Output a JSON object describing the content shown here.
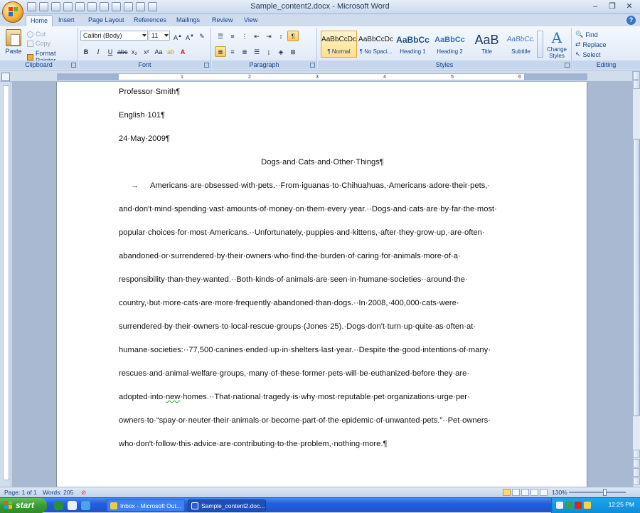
{
  "window": {
    "title": "Sample_content2.docx - Microsoft Word"
  },
  "ribbon": {
    "tabs": [
      {
        "label": "Home"
      },
      {
        "label": "Insert"
      },
      {
        "label": "Page Layout"
      },
      {
        "label": "References"
      },
      {
        "label": "Mailings"
      },
      {
        "label": "Review"
      },
      {
        "label": "View"
      }
    ],
    "clipboard": {
      "label": "Clipboard",
      "paste": "Paste",
      "cut": "Cut",
      "copy": "Copy",
      "format_painter": "Format Painter"
    },
    "font": {
      "label": "Font",
      "family": "Calibri (Body)",
      "size": "11"
    },
    "paragraph": {
      "label": "Paragraph"
    },
    "styles": {
      "label": "Styles",
      "items": [
        {
          "sample": "AaBbCcDc",
          "name": "¶ Normal"
        },
        {
          "sample": "AaBbCcDc",
          "name": "¶ No Spaci..."
        },
        {
          "sample": "AaBbCc",
          "name": "Heading 1"
        },
        {
          "sample": "AaBbCc",
          "name": "Heading 2"
        },
        {
          "sample": "AaB",
          "name": "Title"
        },
        {
          "sample": "AaBbCc.",
          "name": "Subtitle"
        }
      ],
      "change_styles": "Change Styles"
    },
    "editing": {
      "label": "Editing",
      "find": "Find",
      "replace": "Replace",
      "select": "Select"
    }
  },
  "ruler": {
    "numbers": [
      "1",
      "2",
      "3",
      "4",
      "5",
      "6"
    ]
  },
  "document": {
    "lines": [
      "Professor·Smith¶",
      "English·101¶",
      "24·May·2009¶"
    ],
    "title": "Dogs·and·Cats·and·Other·Things¶",
    "tab_mark": "→",
    "body": [
      "Americans·are·obsessed·with·pets.··From·iguanas·to·Chihuahuas,·Americans·adore·their·pets,·",
      "and·don't·mind·spending·vast·amounts·of·money·on·them·every·year.··Dogs·and·cats·are·by·far·the·most·",
      "popular·choices·for·most·Americans.··Unfortunately,·puppies·and·kittens,·after·they·grow·up,·are·often·",
      "abandoned·or·surrendered·by·their·owners·who·find·the·burden·of·caring·for·animals·more·of·a·",
      "responsibility·than·they·wanted.··Both·kinds·of·animals·are·seen·in·humane·societies··around·the·",
      "country,·but·more·cats·are·more·frequently·abandoned·than·dogs.··In·2008,·400,000·cats·were·",
      "surrendered·by·their·owners·to·local·rescue·groups·(Jones·25).·Dogs·don't·turn·up·quite·as·often·at·",
      "humane·societies:··77,500·canines·ended·up·in·shelters·last·year.··Despite·the·good·intentions·of·many·",
      "rescues·and·animal·welfare·groups,·many·of·these·former·pets·will·be·euthanized·before·they·are·",
      "owners·to·“spay·or·neuter·their·animals·or·become·part·of·the·epidemic·of·unwanted·pets.”··Pet·owners·",
      "who·don't·follow·this·advice·are·contributing·to·the·problem,·nothing·more.¶"
    ],
    "adopted_prefix": "adopted·into·",
    "adopted_word": "new",
    "adopted_suffix": "·homes.··That·national·tragedy·is·why·most·reputable·pet·organizations·urge·per·"
  },
  "status": {
    "page": "Page: 1 of 1",
    "words": "Words: 205",
    "zoom": "130%"
  },
  "taskbar": {
    "start": "start",
    "tasks": [
      {
        "label": "Inbox - Microsoft Out..."
      },
      {
        "label": "Sample_content2.doc..."
      }
    ],
    "clock": "12:25 PM"
  }
}
